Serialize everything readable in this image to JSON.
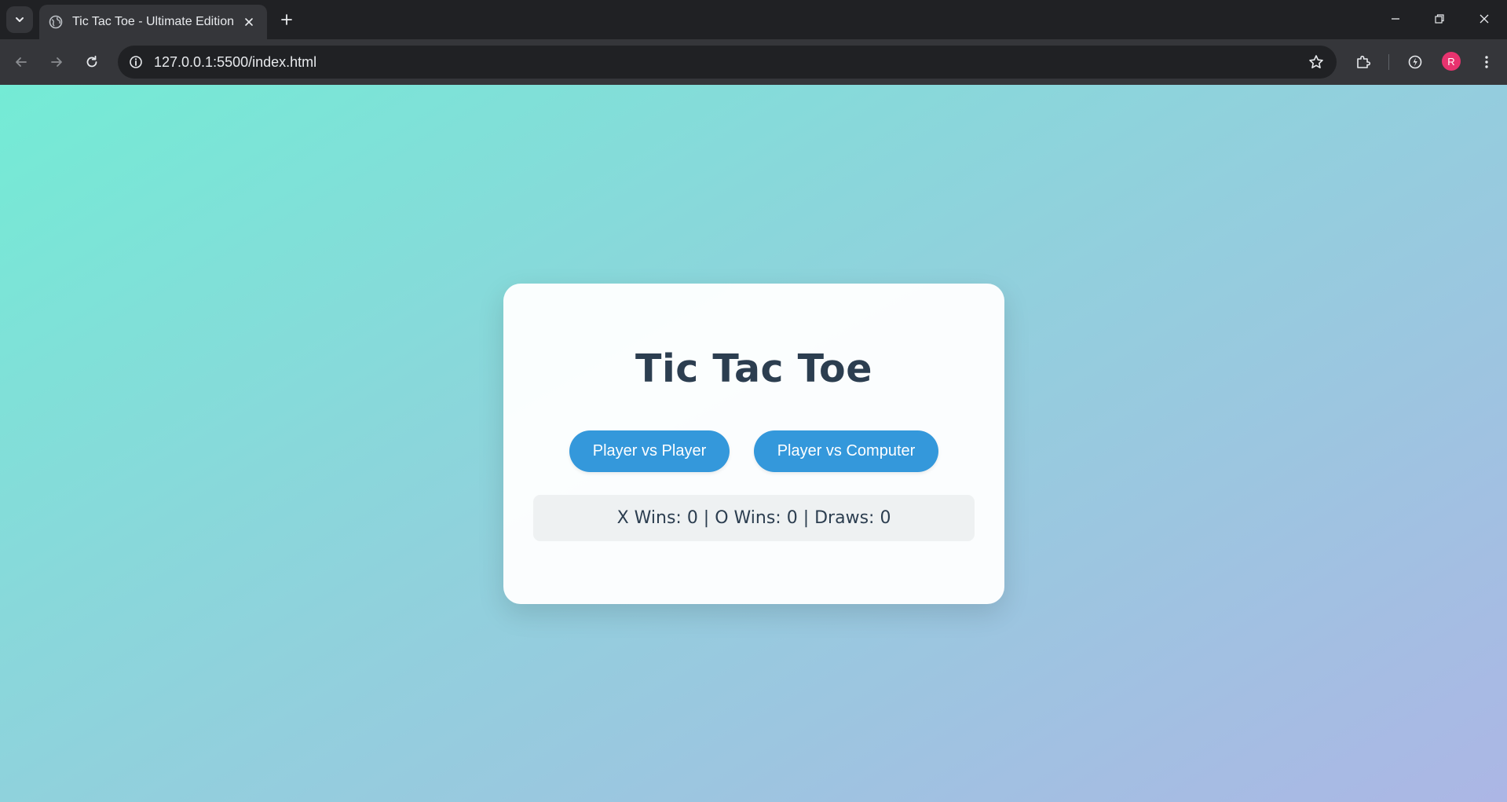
{
  "browser": {
    "tab": {
      "title": "Tic Tac Toe - Ultimate Edition",
      "favicon": "globe-icon"
    },
    "address_bar": {
      "url": "127.0.0.1:5500/index.html"
    },
    "profile_initial": "R",
    "colors": {
      "avatar": "#e8336f",
      "chrome_dark": "#202124",
      "chrome_toolbar": "#35363a"
    }
  },
  "page": {
    "title": "Tic Tac Toe",
    "modes": [
      {
        "label": "Player vs Player"
      },
      {
        "label": "Player vs Computer"
      }
    ],
    "scoreboard": "X Wins: 0 | O Wins: 0 | Draws: 0",
    "colors": {
      "button": "#3498db",
      "title": "#2c3e50",
      "background_start": "#74ebd5",
      "background_end": "#acb6e5"
    }
  }
}
